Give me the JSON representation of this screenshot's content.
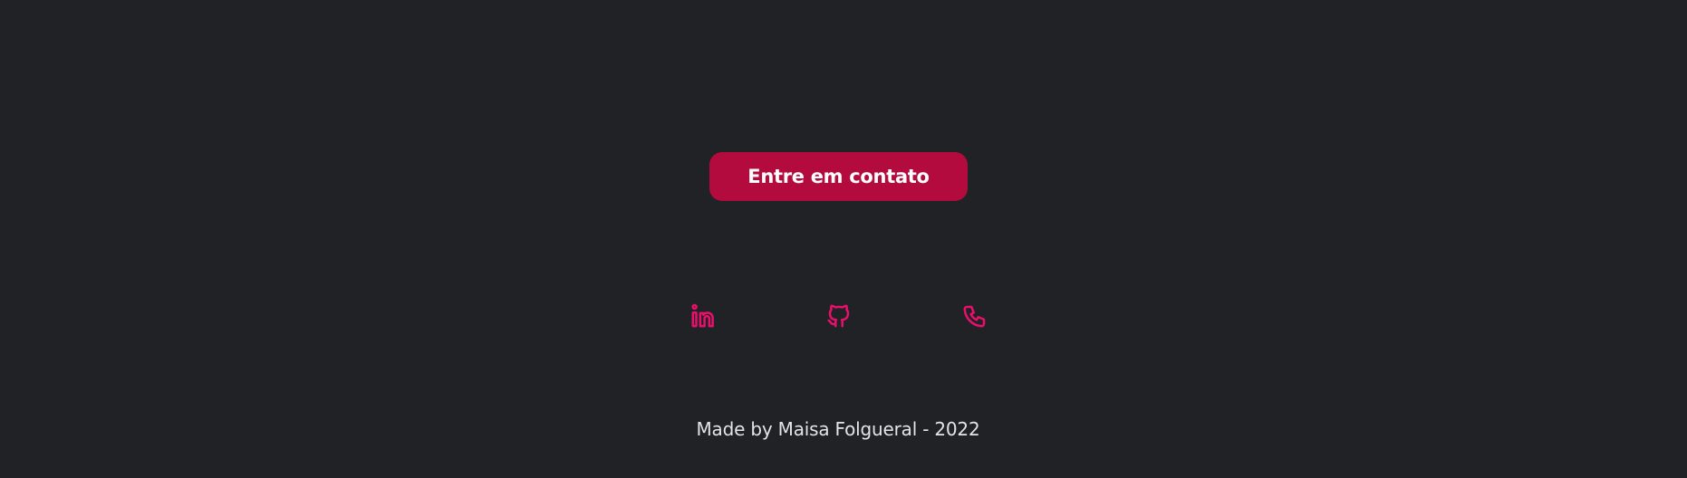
{
  "contact": {
    "button_label": "Entre em contato"
  },
  "social": {
    "accent_color": "#e8106a",
    "items": [
      {
        "icon": "linkedin-icon"
      },
      {
        "icon": "github-icon"
      },
      {
        "icon": "phone-icon"
      }
    ]
  },
  "footer": {
    "text": "Made by Maisa Folgueral - 2022"
  },
  "colors": {
    "background": "#212226",
    "button": "#b30b3e",
    "footer_text": "#e4e4e6"
  }
}
